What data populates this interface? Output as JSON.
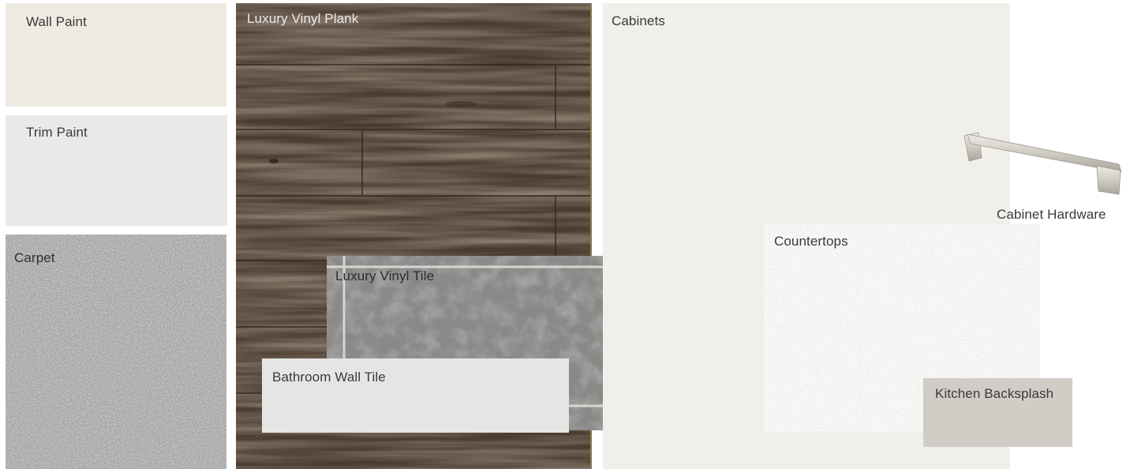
{
  "swatches": {
    "wall_paint": "Wall Paint",
    "trim_paint": "Trim Paint",
    "carpet": "Carpet",
    "luxury_vinyl_plank": "Luxury Vinyl Plank",
    "luxury_vinyl_tile": "Luxury Vinyl Tile",
    "bathroom_wall_tile": "Bathroom Wall Tile",
    "cabinets": "Cabinets",
    "cabinet_hardware": "Cabinet Hardware",
    "countertops": "Countertops",
    "kitchen_backsplash": "Kitchen Backsplash"
  },
  "colors": {
    "wall_paint": "#efebe2",
    "trim_paint": "#e9e9e8",
    "carpet": "#a9a9aa",
    "luxury_vinyl_plank": "#4d3e33",
    "luxury_vinyl_tile": "#8b8a89",
    "bathroom_wall_tile": "#e5e5e4",
    "cabinets": "#f1efe9",
    "countertops": "#f7f7f6",
    "kitchen_backsplash": "#d0ccc6"
  }
}
